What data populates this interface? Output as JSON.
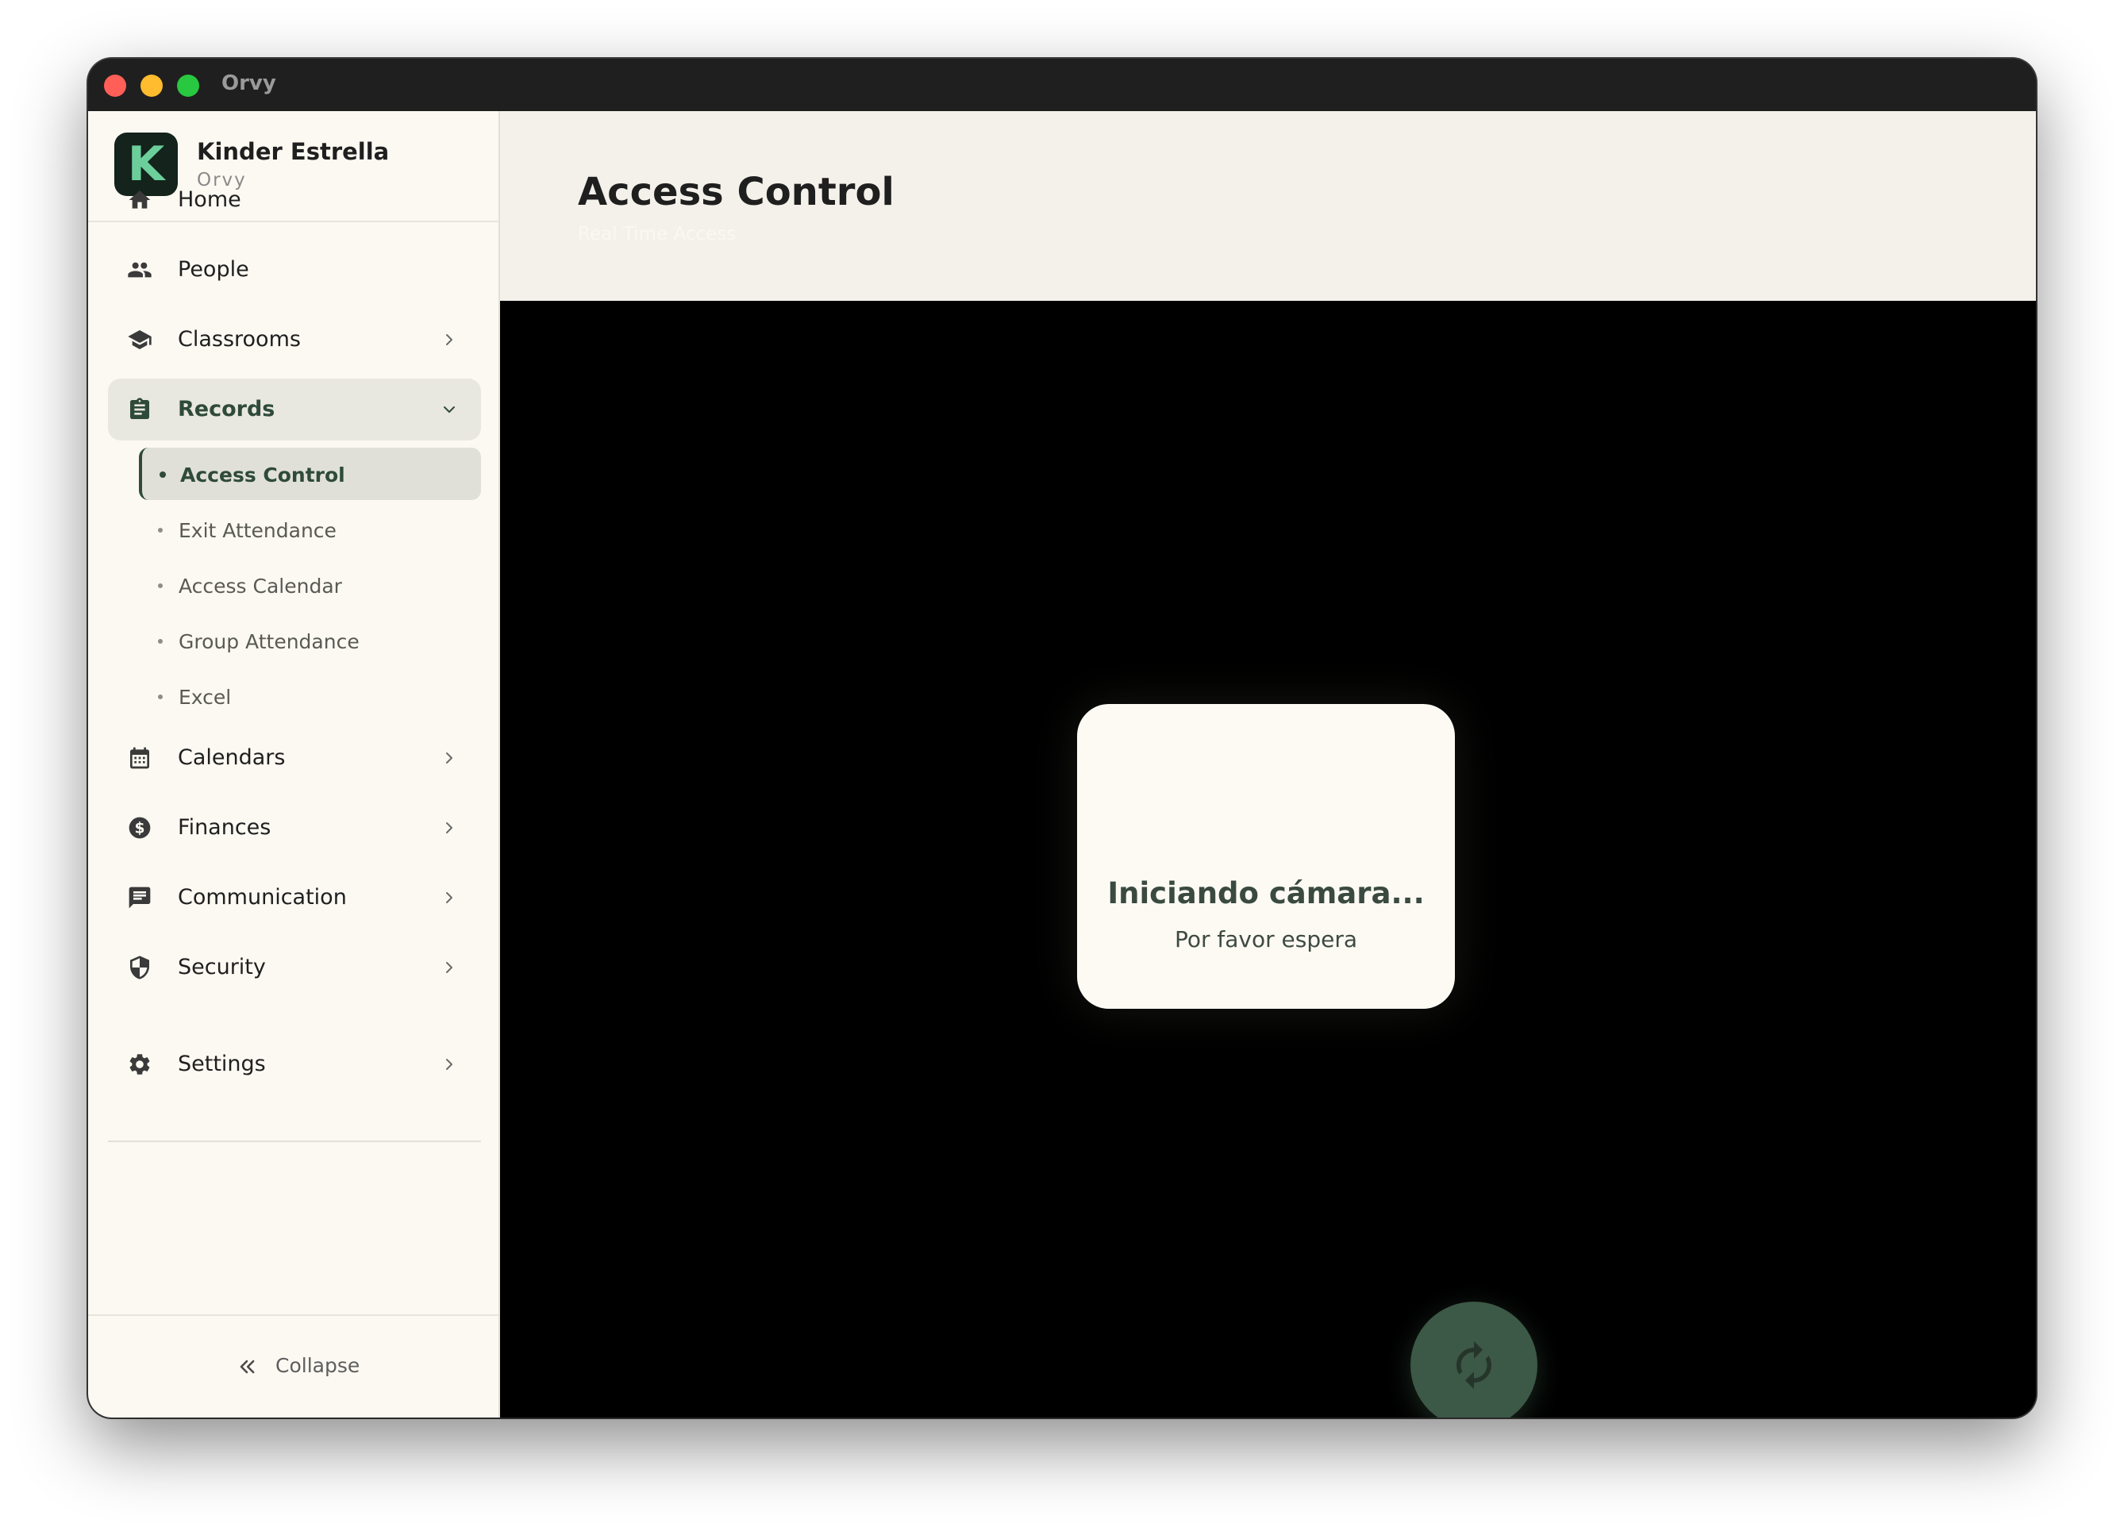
{
  "window": {
    "title": "Orvy"
  },
  "brand": {
    "name": "Kinder Estrella",
    "subtitle": "Orvy",
    "logo_letter": "K"
  },
  "sidebar": {
    "items": [
      {
        "label": "Home",
        "icon": "home-icon"
      },
      {
        "label": "People",
        "icon": "people-icon"
      },
      {
        "label": "Classrooms",
        "icon": "school-icon"
      },
      {
        "label": "Records",
        "icon": "clipboard-icon",
        "expanded": true
      },
      {
        "label": "Calendars",
        "icon": "calendar-icon"
      },
      {
        "label": "Finances",
        "icon": "dollar-icon"
      },
      {
        "label": "Communication",
        "icon": "chat-icon"
      },
      {
        "label": "Security",
        "icon": "shield-icon"
      },
      {
        "label": "Settings",
        "icon": "gear-icon"
      }
    ],
    "records_subitems": [
      {
        "label": "Access Control",
        "active": true
      },
      {
        "label": "Exit Attendance"
      },
      {
        "label": "Access Calendar"
      },
      {
        "label": "Group Attendance"
      },
      {
        "label": "Excel"
      }
    ],
    "collapse_label": "Collapse"
  },
  "header": {
    "title": "Access Control",
    "subtitle": "Real Time Access"
  },
  "camera": {
    "status_title": "Iniciando cámara...",
    "status_subtitle": "Por favor espera",
    "refresh_icon": "refresh-icon"
  },
  "colors": {
    "accent": "#2f4a3a",
    "logo_bg": "#14231b",
    "logo_letter": "#6ccf9b",
    "refresh_button": "#3c5846"
  }
}
